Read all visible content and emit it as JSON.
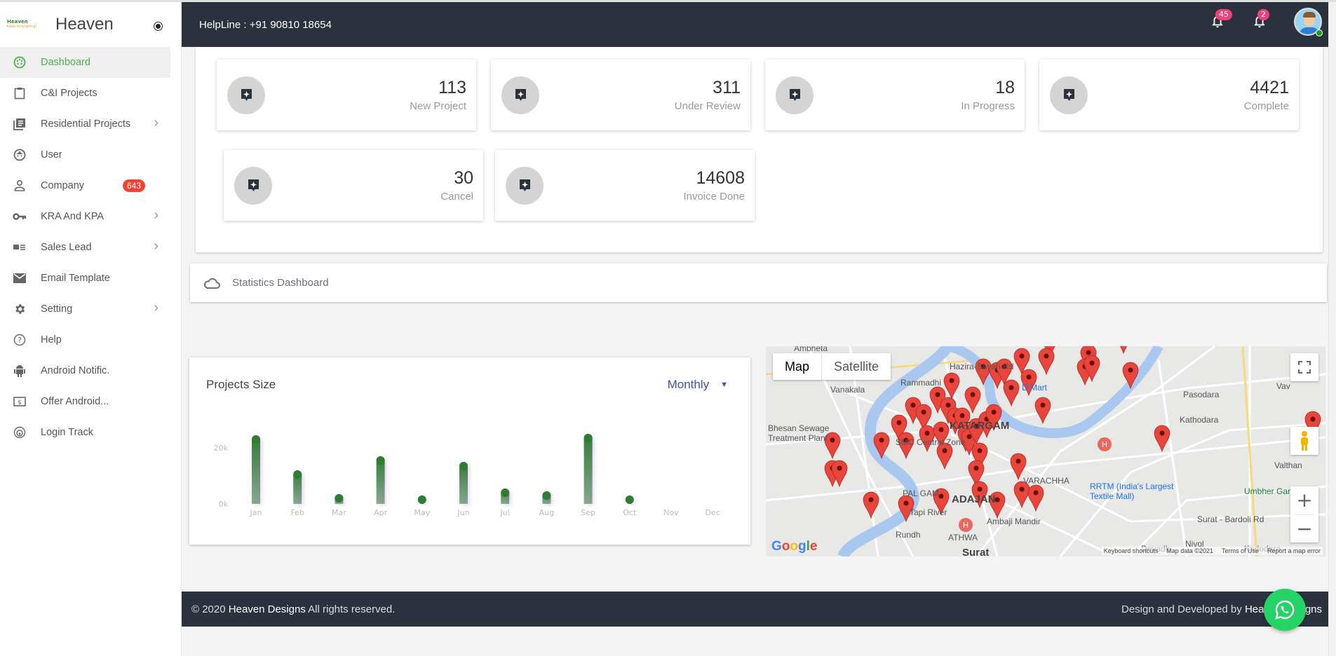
{
  "brand": {
    "name": "Heaven",
    "logo_line1": "Heaven",
    "logo_line2": "Designs Pvt. Ltd.",
    "logo_line3": "Keep Innovating!"
  },
  "sidebar": {
    "items": [
      {
        "label": "Dashboard",
        "icon": "dashboard-icon",
        "active": true,
        "chevron": false
      },
      {
        "label": "C&I Projects",
        "icon": "clipboard-icon",
        "chevron": false
      },
      {
        "label": "Residential Projects",
        "icon": "library-books-icon",
        "chevron": true
      },
      {
        "label": "User",
        "icon": "face-icon",
        "chevron": false
      },
      {
        "label": "Company",
        "icon": "person-outline-icon",
        "chevron": false,
        "badge": "643"
      },
      {
        "label": "KRA And KPA",
        "icon": "key-icon",
        "chevron": true
      },
      {
        "label": "Sales Lead",
        "icon": "view-list-icon",
        "chevron": true
      },
      {
        "label": "Email Template",
        "icon": "mail-icon",
        "chevron": false
      },
      {
        "label": "Setting",
        "icon": "gear-icon",
        "chevron": true
      },
      {
        "label": "Help",
        "icon": "help-circle-icon",
        "chevron": false
      },
      {
        "label": "Android Notific.",
        "icon": "android-icon",
        "chevron": false
      },
      {
        "label": "Offer Android...",
        "icon": "dollar-box-icon",
        "chevron": false
      },
      {
        "label": "Login Track",
        "icon": "track-icon",
        "chevron": false
      }
    ]
  },
  "header": {
    "helpline": "HelpLine : +91 90810 18654",
    "notifications_count": "45",
    "alerts_count": "2"
  },
  "cards": [
    {
      "value": "113",
      "label": "New Project"
    },
    {
      "value": "311",
      "label": "Under Review"
    },
    {
      "value": "18",
      "label": "In Progress"
    },
    {
      "value": "4421",
      "label": "Complete"
    },
    {
      "value": "30",
      "label": "Cancel"
    },
    {
      "value": "14608",
      "label": "Invoice Done"
    }
  ],
  "stats": {
    "title": "Statistics Dashboard"
  },
  "chart_panel": {
    "title": "Projects Size",
    "period": "Monthly"
  },
  "chart_data": {
    "type": "bar",
    "title": "Projects Size",
    "categories": [
      "Jan",
      "Feb",
      "Mar",
      "Apr",
      "May",
      "Jun",
      "Jul",
      "Aug",
      "Sep",
      "Oct",
      "Nov",
      "Dec"
    ],
    "values": [
      24500,
      12000,
      3500,
      17000,
      500,
      15000,
      5500,
      4500,
      25000,
      0,
      0,
      0
    ],
    "yticks": [
      "0k",
      "20k"
    ],
    "ytick_values": [
      0,
      20000
    ],
    "xlabel": "",
    "ylabel": "",
    "grid": false,
    "bar_color": "#2e7d32"
  },
  "map": {
    "type_map": "Map",
    "type_satellite": "Satellite",
    "labels": [
      "Ambheta",
      "Vanakala",
      "Rammadhi",
      "Bhesan Sewage Treatment Plant",
      "KATARGAM",
      "SMC Central Zone",
      "D Mart",
      "Pasodara",
      "Kathodara",
      "Vav",
      "Valthan",
      "VARACHHA",
      "RRTM (India's Largest Textile Mall)",
      "Umbher Garden",
      "PAL GAM",
      "ADAJAN",
      "Ambaji Mandir",
      "Rundh",
      "ATHWA",
      "Surat",
      "Devadh",
      "Nivol",
      "Kadodara",
      "Hazira-Sayan Rd",
      "Surat - Bardoli Rd",
      "Tapi River"
    ],
    "footer": [
      "Keyboard shortcuts",
      "Map data ©2021",
      "Terms of Use",
      "Report a map error"
    ],
    "google": "Google"
  },
  "footer": {
    "copyright_prefix": "© 2020 ",
    "company": "Heaven Designs",
    "copyright_suffix": " All rights reserved.",
    "credit_prefix": "Design and Developed by ",
    "credit_company": "Heaven Designs"
  },
  "colors": {
    "accent": "#4caf50",
    "header": "#2b323d",
    "badge": "#f44336",
    "notif": "#f0427a",
    "select": "#3f51b5",
    "whatsapp": "#25d366"
  }
}
